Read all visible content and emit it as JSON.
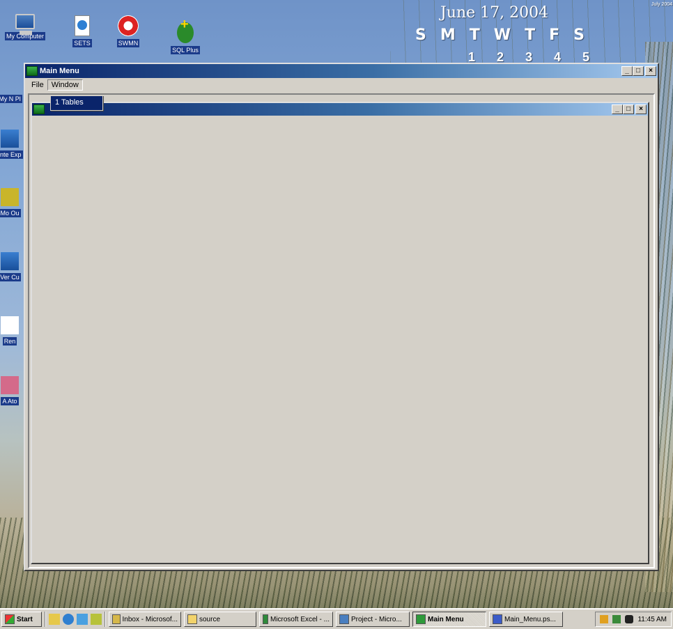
{
  "desktop": {
    "icons": [
      {
        "label": "My Computer",
        "icon": "my-computer-icon"
      },
      {
        "label": "SETS",
        "icon": "document-icon"
      },
      {
        "label": "SWMN",
        "icon": "stop-sign-icon"
      },
      {
        "label": "SQL Plus",
        "icon": "sql-plus-icon"
      }
    ],
    "side_icons": [
      "My N Pl",
      "Inte Exp",
      "Mo Ou",
      "Ver Cu",
      "Ren",
      "A Ato"
    ],
    "calendar": {
      "title": "June 17, 2004",
      "days": [
        "S",
        "M",
        "T",
        "W",
        "T",
        "F",
        "S"
      ],
      "dates": [
        "1",
        "2",
        "3",
        "4",
        "5"
      ],
      "mini_title": "July 2004"
    }
  },
  "main_window": {
    "title": "Main Menu",
    "menu": [
      "File",
      "Window"
    ],
    "window_menu_item": "1 Tables"
  },
  "child_window": {
    "title": ""
  },
  "window_controls": {
    "minimize": "_",
    "maximize": "□",
    "close": "×"
  },
  "taskbar": {
    "start_label": "Start",
    "tasks": [
      {
        "label": "Inbox - Microsof...",
        "active": false
      },
      {
        "label": "source",
        "active": false
      },
      {
        "label": "Microsoft Excel - ...",
        "active": false
      },
      {
        "label": "Project - Micro...",
        "active": false
      },
      {
        "label": "Main Menu",
        "active": true
      },
      {
        "label": "Main_Menu.ps...",
        "active": false
      }
    ],
    "clock": "11:45 AM"
  }
}
